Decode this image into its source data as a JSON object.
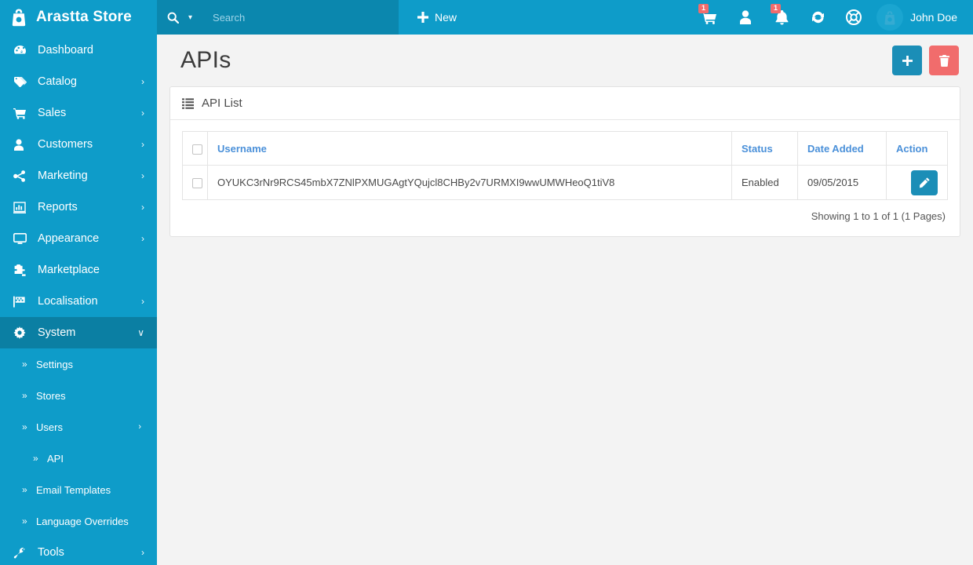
{
  "brand": {
    "name": "Arastta Store",
    "logo_icon": "arastta-bag-logo-icon"
  },
  "sidebar": {
    "items": [
      {
        "label": "Dashboard",
        "icon": "dashboard-gauge-icon",
        "caret": "",
        "active": false
      },
      {
        "label": "Catalog",
        "icon": "tag-icon",
        "caret": "›",
        "active": false
      },
      {
        "label": "Sales",
        "icon": "cart-icon",
        "caret": "›",
        "active": false
      },
      {
        "label": "Customers",
        "icon": "user-icon",
        "caret": "›",
        "active": false
      },
      {
        "label": "Marketing",
        "icon": "share-icon",
        "caret": "›",
        "active": false
      },
      {
        "label": "Reports",
        "icon": "bar-chart-icon",
        "caret": "›",
        "active": false
      },
      {
        "label": "Appearance",
        "icon": "desktop-icon",
        "caret": "›",
        "active": false
      },
      {
        "label": "Marketplace",
        "icon": "puzzle-icon",
        "caret": "",
        "active": false
      },
      {
        "label": "Localisation",
        "icon": "flag-icon",
        "caret": "›",
        "active": false
      },
      {
        "label": "System",
        "icon": "gear-icon",
        "caret": "∨",
        "active": true
      }
    ],
    "system_submenu": [
      {
        "label": "Settings",
        "chevron": "»",
        "caret": "",
        "level": 1
      },
      {
        "label": "Stores",
        "chevron": "»",
        "caret": "",
        "level": 1
      },
      {
        "label": "Users",
        "chevron": "»",
        "caret": "›",
        "level": 1
      },
      {
        "label": "API",
        "chevron": "»",
        "caret": "",
        "level": 2
      },
      {
        "label": "Email Templates",
        "chevron": "»",
        "caret": "",
        "level": 1
      },
      {
        "label": "Language Overrides",
        "chevron": "»",
        "caret": "",
        "level": 1
      }
    ],
    "footer_item": {
      "label": "Tools",
      "icon": "wrench-icon",
      "caret": "›"
    }
  },
  "topbar": {
    "search": {
      "placeholder": "Search",
      "value": "",
      "icon": "search-icon",
      "dropdown_caret": "▾"
    },
    "new_button": {
      "label": "New",
      "icon": "plus-icon"
    },
    "tools": [
      {
        "name": "cart-icon",
        "badge": "1"
      },
      {
        "name": "user-icon",
        "badge": ""
      },
      {
        "name": "bell-icon",
        "badge": "1"
      },
      {
        "name": "refresh-icon",
        "badge": ""
      },
      {
        "name": "lifebuoy-help-icon",
        "badge": ""
      }
    ],
    "avatar_icon": "arastta-bag-logo-icon",
    "user_name": "John Doe"
  },
  "page": {
    "title": "APIs",
    "add_button_label": "",
    "delete_button_label": "",
    "add_icon": "plus-icon",
    "delete_icon": "trash-icon"
  },
  "panel": {
    "icon": "list-icon",
    "title": "API List",
    "columns": [
      {
        "key": "check",
        "label": ""
      },
      {
        "key": "username",
        "label": "Username"
      },
      {
        "key": "status",
        "label": "Status"
      },
      {
        "key": "date_added",
        "label": "Date Added"
      },
      {
        "key": "action",
        "label": "Action"
      }
    ],
    "rows": [
      {
        "username": "OYUKC3rNr9RCS45mbX7ZNlPXMUGAgtYQujcl8CHBy2v7URMXI9wwUMWHeoQ1tiV8",
        "status": "Enabled",
        "date_added": "09/05/2015",
        "edit_icon": "pencil-icon"
      }
    ],
    "footer": "Showing 1 to 1 of 1 (1 Pages)"
  },
  "colors": {
    "brand_blue": "#0e9cc9",
    "dark_blue": "#0b7fa3",
    "search_blue": "#0b87ae",
    "accent_blue": "#1b8eb7",
    "danger_red": "#f16c6c",
    "link_blue": "#4a90d9",
    "page_bg": "#f3f3f3"
  }
}
